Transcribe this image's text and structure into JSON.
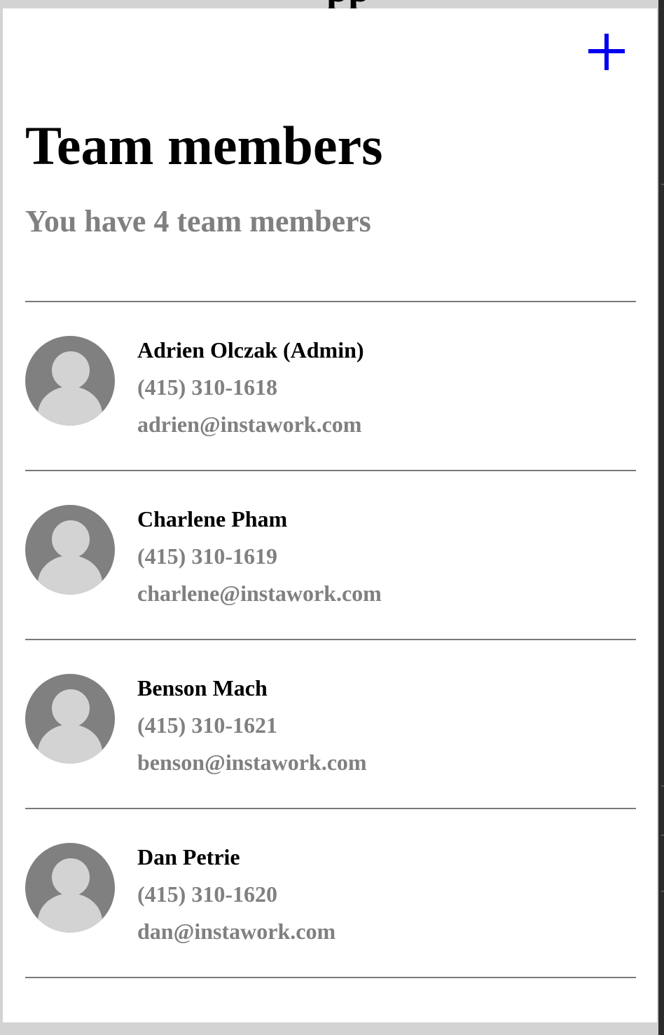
{
  "top_cutoff_text": "pp",
  "header": {
    "add_icon": "plus-icon",
    "accent_color": "#0000ee",
    "title": "Team members",
    "subtitle": "You have 4 team members"
  },
  "members": [
    {
      "name": "Adrien Olczak (Admin)",
      "phone": "(415) 310-1618",
      "email": "adrien@instawork.com",
      "avatar_icon": "default-avatar-icon"
    },
    {
      "name": "Charlene Pham",
      "phone": "(415) 310-1619",
      "email": "charlene@instawork.com",
      "avatar_icon": "default-avatar-icon"
    },
    {
      "name": "Benson Mach",
      "phone": "(415) 310-1621",
      "email": "benson@instawork.com",
      "avatar_icon": "default-avatar-icon"
    },
    {
      "name": "Dan Petrie",
      "phone": "(415) 310-1620",
      "email": "dan@instawork.com",
      "avatar_icon": "default-avatar-icon"
    }
  ],
  "colors": {
    "primary_text": "#000000",
    "secondary_text": "#808080",
    "divider": "#7a7a7a",
    "avatar_bg": "#808080",
    "avatar_fg": "#d3d3d3",
    "page_bg": "#ffffff",
    "frame_bg": "#d3d3d3"
  }
}
